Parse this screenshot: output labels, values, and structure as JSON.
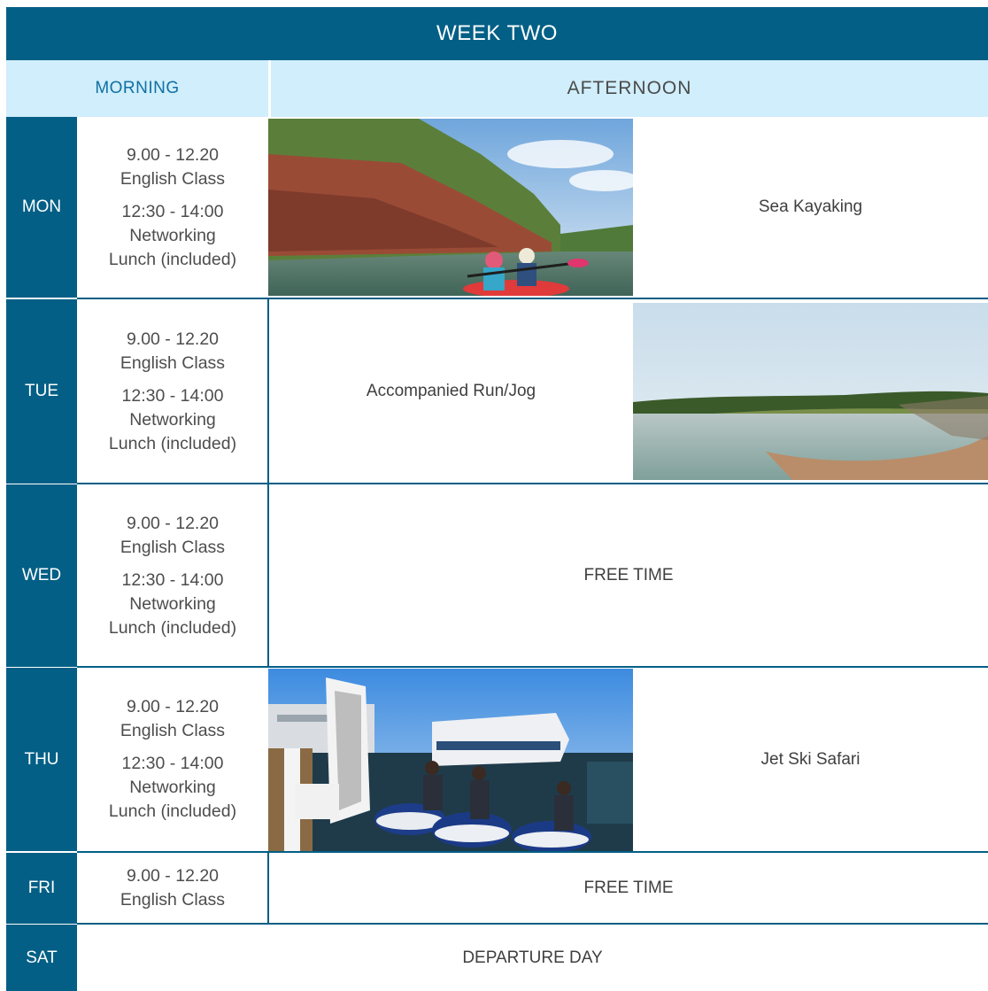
{
  "header": {
    "title": "WEEK TWO"
  },
  "periods": {
    "morning": "MORNING",
    "afternoon": "AFTERNOON"
  },
  "morning_sessions": {
    "full": {
      "class_time": "9.00 - 12.20",
      "class_name": "English Class",
      "lunch_time": "12:30 - 14:00",
      "lunch_name_1": "Networking",
      "lunch_name_2": "Lunch (included)"
    },
    "short": {
      "class_time": "9.00 - 12.20",
      "class_name": "English Class"
    }
  },
  "days": [
    {
      "day": "MON",
      "activity": "Sea Kayaking",
      "photo": "sea-kayaking-photo"
    },
    {
      "day": "TUE",
      "activity": "Accompanied Run/Jog",
      "photo": "beach-bay-photo"
    },
    {
      "day": "WED",
      "activity": "FREE TIME"
    },
    {
      "day": "THU",
      "activity": "Jet Ski Safari",
      "photo": "jet-ski-photo"
    },
    {
      "day": "FRI",
      "activity": "FREE TIME"
    },
    {
      "day": "SAT",
      "activity": "DEPARTURE DAY"
    }
  ],
  "colors": {
    "header": "#035f85",
    "period_band": "#d0eefb",
    "morning_text": "#1170a3",
    "body_text": "#4d4d4d"
  }
}
